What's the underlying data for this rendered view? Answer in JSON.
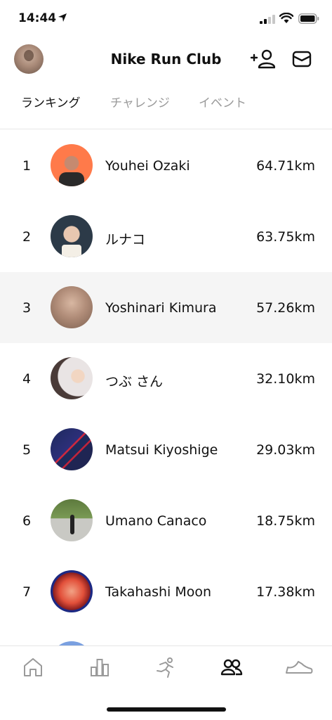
{
  "status_bar": {
    "time": "14:44"
  },
  "header": {
    "title": "Nike Run Club"
  },
  "tabs": [
    {
      "label": "ランキング",
      "active": true
    },
    {
      "label": "チャレンジ",
      "active": false
    },
    {
      "label": "イベント",
      "active": false
    }
  ],
  "leaderboard": [
    {
      "rank": "1",
      "name": "Youhei Ozaki",
      "distance": "64.71km"
    },
    {
      "rank": "2",
      "name": "ルナコ",
      "distance": "63.75km"
    },
    {
      "rank": "3",
      "name": "Yoshinari Kimura",
      "distance": "57.26km",
      "highlighted": true
    },
    {
      "rank": "4",
      "name": "つぶ さん",
      "distance": "32.10km"
    },
    {
      "rank": "5",
      "name": "Matsui Kiyoshige",
      "distance": "29.03km"
    },
    {
      "rank": "6",
      "name": "Umano Canaco",
      "distance": "18.75km"
    },
    {
      "rank": "7",
      "name": "Takahashi Moon",
      "distance": "17.38km"
    }
  ],
  "bottom_nav": [
    {
      "icon": "home-icon",
      "active": false
    },
    {
      "icon": "activity-icon",
      "active": false
    },
    {
      "icon": "run-icon",
      "active": false
    },
    {
      "icon": "club-icon",
      "active": true
    },
    {
      "icon": "shoe-icon",
      "active": false
    }
  ],
  "colors": {
    "active_text": "#111111",
    "inactive_text": "#9a9a9a",
    "highlight_row": "#f5f5f5"
  }
}
